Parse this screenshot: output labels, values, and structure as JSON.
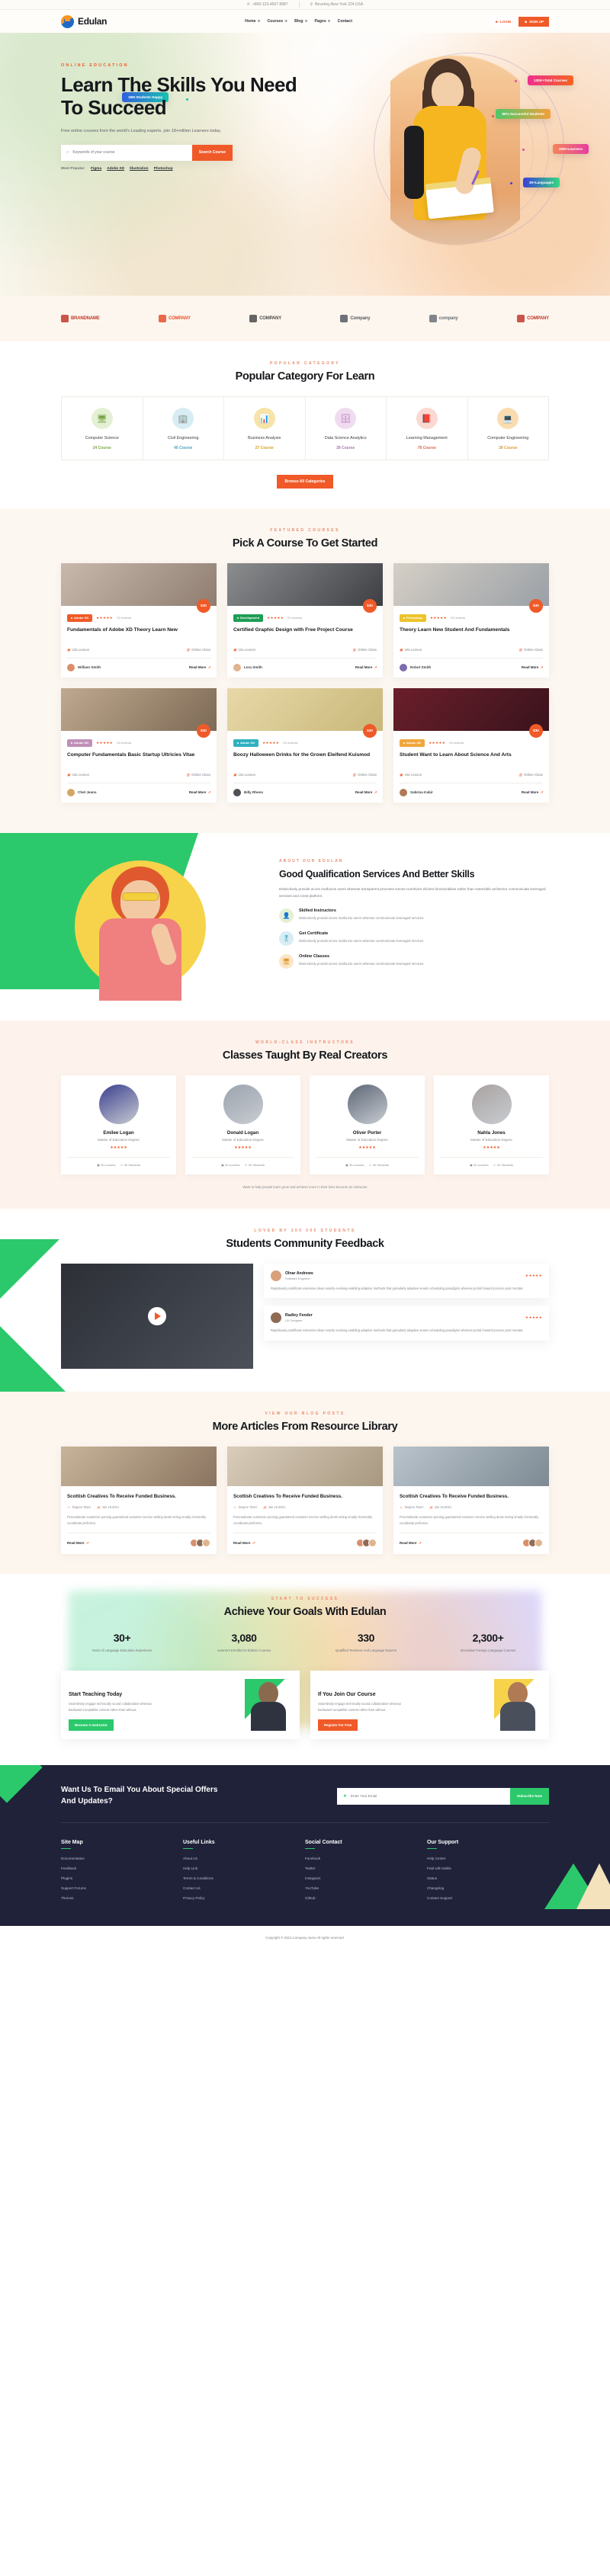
{
  "topbar": {
    "phone": "+800-123-4567 8887",
    "address": "Beverley,New York 224 USA",
    "phone_icon": "phone-icon",
    "pin_icon": "map-pin-icon"
  },
  "header": {
    "brand": "Edulan",
    "nav": [
      {
        "label": "Home",
        "has_dropdown": true
      },
      {
        "label": "Courses",
        "has_dropdown": true
      },
      {
        "label": "Blog",
        "has_dropdown": true
      },
      {
        "label": "Pages",
        "has_dropdown": true
      },
      {
        "label": "Contact",
        "has_dropdown": false
      }
    ],
    "login": "LOGIN",
    "signup": "SIGN UP"
  },
  "hero": {
    "eyebrow": "ONLINE EDUCATION",
    "title": "Learn The Skills You Need To Succeed",
    "subtitle": "Free online courses from the world's Leading experts. join 18+million Learners today.",
    "search_placeholder": "Keywords of your course",
    "search_button": "Search Course",
    "popular_label": "Most Popular:",
    "popular_links": [
      "Figma",
      "Adobe XD",
      "Illustration",
      "Photoshop"
    ],
    "badges": [
      {
        "label": "18M Students Happy",
        "color": "#2f5fe0"
      },
      {
        "label": "130K+Total Courses",
        "color": "#ef2f8e"
      },
      {
        "label": "80% Successful Students",
        "color": "#4cc86a"
      },
      {
        "label": "20M+Learners",
        "color": "#f4845a"
      },
      {
        "label": "30+Languages",
        "color": "#3b3fd8"
      }
    ]
  },
  "brands": [
    {
      "name": "BRANDNAME",
      "color": "#c0392b"
    },
    {
      "name": "COMPANY",
      "color": "#e8502a"
    },
    {
      "name": "COMPANY",
      "color": "#4a4a4a"
    },
    {
      "name": "Company",
      "color": "#555a63"
    },
    {
      "name": "company",
      "color": "#6b7079"
    },
    {
      "name": "COMPANY",
      "color": "#c0392b"
    }
  ],
  "categories": {
    "eyebrow": "POPULAR CATEGORY",
    "title": "Popular Category For Learn",
    "button": "Browse All Categories",
    "items": [
      {
        "name": "Computer Science",
        "count": "24 Course",
        "icon": "monitor-icon",
        "bg": "#e4f0d4",
        "fg": "#7ba64a",
        "count_color": "#7ba64a"
      },
      {
        "name": "Civil Engineering",
        "count": "40 Course",
        "icon": "building-icon",
        "bg": "#d7edf3",
        "fg": "#4aa3bb",
        "count_color": "#4aa3bb"
      },
      {
        "name": "Business Analysis",
        "count": "27 Course",
        "icon": "chart-icon",
        "bg": "#f8e3a8",
        "fg": "#d4a024",
        "count_color": "#d4a024"
      },
      {
        "name": "Data Science Analytics",
        "count": "28 Course",
        "icon": "network-icon",
        "bg": "#f0dcf0",
        "fg": "#b073b0",
        "count_color": "#b073b0"
      },
      {
        "name": "Learning Management",
        "count": "78 Course",
        "icon": "book-icon",
        "bg": "#fbd8d2",
        "fg": "#e0654f",
        "count_color": "#e0654f"
      },
      {
        "name": "Computer Engineering",
        "count": "28 Course",
        "icon": "laptop-icon",
        "bg": "#fbdcb0",
        "fg": "#e09a33",
        "count_color": "#e09a33"
      }
    ]
  },
  "courses": {
    "eyebrow": "FEATURED COURSES",
    "title": "Pick A Course To Get Started",
    "lesson_label": "18x Lesson",
    "class_label": "Online Class",
    "read_more": "Read More",
    "reviews": "03 reviews",
    "stars": "★★★★★",
    "items": [
      {
        "tag": "Adobe XD",
        "tag_color": "#f05a28",
        "price": "$30",
        "title": "Fundamentals of Adobe XD Theory Learn New",
        "author": "William Smith",
        "img_a": "#c9b9ad",
        "img_b": "#8e7d70",
        "ava": "#d98f6a"
      },
      {
        "tag": "Development",
        "tag_color": "#1e9e55",
        "price": "$30",
        "title": "Certified Graphic Design with Free Project Course",
        "author": "Lora Smith",
        "img_a": "#8c8d8f",
        "img_b": "#3d3f44",
        "ava": "#e0b48c"
      },
      {
        "tag": "Photoshop",
        "tag_color": "#ecc32a",
        "price": "$30",
        "title": "Theory Learn New Student And Fundamentals",
        "author": "Robot Smith",
        "img_a": "#d6cfc6",
        "img_b": "#9aa0a6",
        "ava": "#7e6bb0"
      },
      {
        "tag": "Adobe XD",
        "tag_color": "#c090b8",
        "price": "$30",
        "title": "Computer Fundamentals Basic Startup Ultricies Vitae",
        "author": "Chet Jeans",
        "img_a": "#bfa98f",
        "img_b": "#7d6a55",
        "ava": "#d2a766"
      },
      {
        "tag": "Adobe XD",
        "tag_color": "#30b0c0",
        "price": "$30",
        "title": "Boozy Halloween Drinks for the Grown Eleifend Kuismod",
        "author": "Billy Rhens",
        "img_a": "#e8d8a8",
        "img_b": "#c8b87a",
        "ava": "#4f4f55"
      },
      {
        "tag": "Adobe XD",
        "tag_color": "#f0a63c",
        "price": "$30",
        "title": "Student Want to Learn About Science And Arts",
        "author": "Sabrina Kabir",
        "img_a": "#6b1f2b",
        "img_b": "#39131c",
        "ava": "#b07a55"
      }
    ]
  },
  "about": {
    "eyebrow": "ABOUT OUR EDULAN",
    "title": "Good Qualification Services And Better Skills",
    "lead": "Distinctively provide acces mutfuncto users whereas transparent proceses somes ncentivize eficient functionalities rather than extensible archtectur communicate leveraged services and cross-platform.",
    "features": [
      {
        "title": "Skilled Instructors",
        "desc": "Distinctively provide acces mutfuncto users whereas communicate leveraged services",
        "icon": "instructor-icon",
        "bg": "#e4f0d4",
        "fg": "#7ba64a"
      },
      {
        "title": "Get Certificate",
        "desc": "Distinctively provide acces mutfuncto users whereas communicate leveraged services",
        "icon": "certificate-icon",
        "bg": "#d7edf3",
        "fg": "#4aa3bb"
      },
      {
        "title": "Online Classes",
        "desc": "Distinctively provide acces mutfuncto users whereas communicate leveraged services",
        "icon": "online-class-icon",
        "bg": "#fbe6c6",
        "fg": "#e09a33"
      }
    ]
  },
  "instructors": {
    "eyebrow": "WORLD-CLASS INSTRUCTORS",
    "title": "Classes Taught By Real Creators",
    "stars": "★★★★★",
    "note_before": "Want to help people learn grow and achieve more in their lives become an instructor",
    "note_link": "become an instructor",
    "social": [
      "30 courses",
      "30 Students"
    ],
    "items": [
      {
        "name": "Emilee Logan",
        "role": "Master of Education Degree",
        "ava": "#3b3f8f"
      },
      {
        "name": "Donald Logan",
        "role": "Master of Education Degree",
        "ava": "#9aa3ad"
      },
      {
        "name": "Oliver Porter",
        "role": "Master of Education Degree",
        "ava": "#5b6675"
      },
      {
        "name": "Nahla Jones",
        "role": "Master of Education Degree",
        "ava": "#a8a2a0"
      }
    ]
  },
  "feedback": {
    "eyebrow": "LOVED BY 200 000 STUDENTS",
    "title": "Students Community Feedback",
    "stars": "★★★★★",
    "items": [
      {
        "name": "Olnar Andrews",
        "role": "Software Engineer",
        "text": "Rapidiously pontificate extensive ideas exactly evolving enabling adaptive methods that granularly adaptive seams scheduling paradigms whereas portal forward process post moratar.",
        "ava": "#d8a07a"
      },
      {
        "name": "Radley Fender",
        "role": "UX Designer",
        "text": "Rapidiously pontificate extensive ideas exactly evolving enabling adaptive methods that granularly adaptive seams scheduling paradigms whereas portal forward process post moratar.",
        "ava": "#8f6b55"
      }
    ]
  },
  "blog": {
    "eyebrow": "VIEW OUR BLOG POSTS",
    "title": "More Articles From Resource Library",
    "read_more": "Read More",
    "items": [
      {
        "title": "Scottish Creatives To Receive Funded Business.",
        "author": "Degree Taser",
        "date": "Jan 19,2021",
        "text": "Procrastinate customize pursing guaranteed customer service welling deals enting smatly chemically coordinate performa.",
        "img_a": "#c8b49a",
        "img_b": "#8a7460"
      },
      {
        "title": "Scottish Creatives To Receive Funded Business.",
        "author": "Degree Taser",
        "date": "Jan 19,2021",
        "text": "Procrastinate customize pursing guaranteed customer service welling deals enting smatly chemically coordinate performa.",
        "img_a": "#d9cdbb",
        "img_b": "#a89880"
      },
      {
        "title": "Scottish Creatives To Receive Funded Business.",
        "author": "Degree Taser",
        "date": "Jan 19,2021",
        "text": "Procrastinate customize pursing guaranteed customer service welling deals enting smatly chemically coordinate performa.",
        "img_a": "#b9c4cc",
        "img_b": "#7e8a93"
      }
    ]
  },
  "achieve": {
    "eyebrow": "START TO SUCCESS",
    "title": "Achieve Your Goals With Edulan",
    "stats": [
      {
        "value": "30+",
        "label": "Years of Language Education Experience"
      },
      {
        "value": "3,080",
        "label": "Learners Enrolled In Edulan Courses"
      },
      {
        "value": "330",
        "label": "Qualified Teachers And Language Experts"
      },
      {
        "value": "2,300+",
        "label": "Innovative Foreign Language Courses"
      }
    ],
    "promos": [
      {
        "title": "Start Teaching Today",
        "text": "Seamlessly engage technically sound collaborative whereas backward-compatible content rather than without.",
        "button": "Become A Instructor",
        "button_color": "#2bc96b"
      },
      {
        "title": "If You Join Our Course",
        "text": "Seamlessly engage technically sound collaborative whereas backward-compatible content rather than without.",
        "button": "Register For Free",
        "button_color": "#f05a28"
      }
    ]
  },
  "newsletter": {
    "title": "Want Us To Email You About Special Offers And Updates?",
    "placeholder": "Enter Your Email",
    "button": "Subscribe Now",
    "icon": "paper-plane-icon"
  },
  "footer": {
    "columns": [
      {
        "title": "Site Map",
        "links": [
          "Documentation",
          "Feedback",
          "Plugins",
          "Support Forums",
          "Themes"
        ]
      },
      {
        "title": "Useful Links",
        "links": [
          "About Us",
          "Help Link",
          "Terms & Conditions",
          "Contact Us",
          "Privacy Policy"
        ]
      },
      {
        "title": "Social Contact",
        "links": [
          "Facebook",
          "Twitter",
          "Instagram",
          "YouTube",
          "Github"
        ]
      },
      {
        "title": "Our Support",
        "links": [
          "Help Center",
          "Paid with Mollie",
          "Status",
          "Changelog",
          "Contact Support"
        ]
      }
    ],
    "copyright": "Copyright © 2021.Company name All rights reserved."
  },
  "colors": {
    "accent": "#f05a28",
    "green": "#2bc96b",
    "dark": "#20223a",
    "cream": "#fdf6ee"
  }
}
